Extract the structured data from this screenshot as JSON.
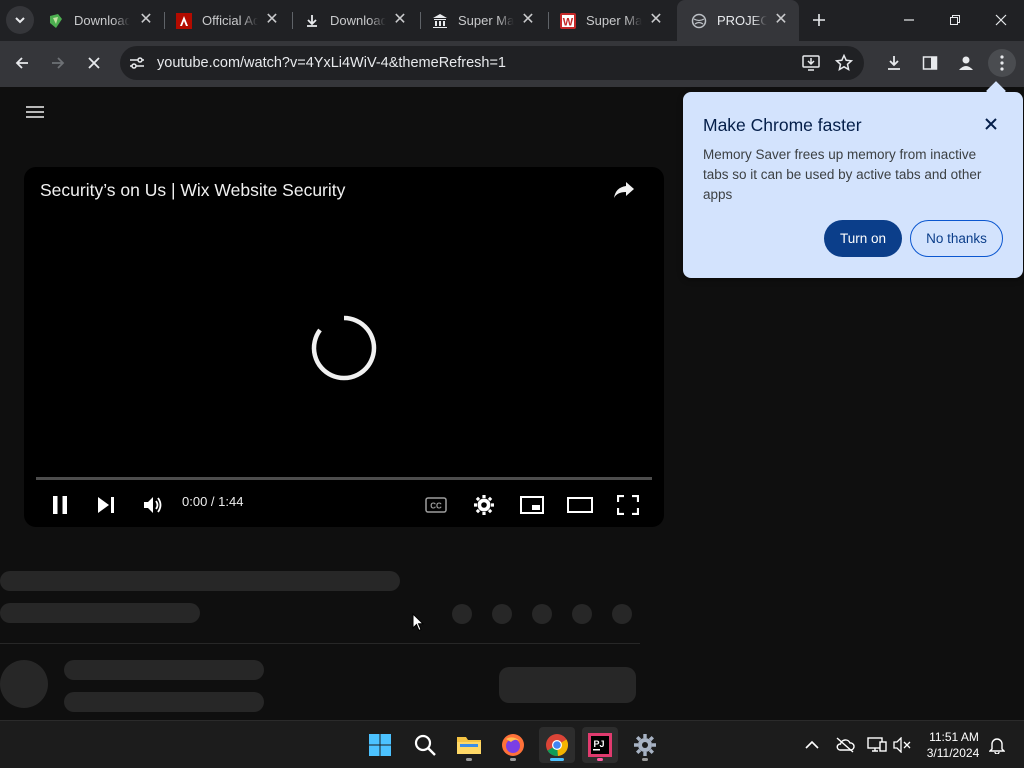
{
  "browser": {
    "tabs": [
      {
        "title": "Download",
        "favicon": "green-app-icon",
        "active": false
      },
      {
        "title": "Official Ad",
        "favicon": "adobe-icon",
        "active": false
      },
      {
        "title": "Download",
        "favicon": "download-icon",
        "active": false
      },
      {
        "title": "Super Mar",
        "favicon": "museum-icon",
        "active": false
      },
      {
        "title": "Super Mar",
        "favicon": "w-logo-icon",
        "active": false
      },
      {
        "title": "PROJECT",
        "favicon": "chrome-globe-icon",
        "active": true
      }
    ],
    "url": "youtube.com/watch?v=4YxLi4WiV-4&themeRefresh=1"
  },
  "video": {
    "title": "Security’s on Us | Wix Website Security",
    "time": "0:00 / 1:44"
  },
  "popup": {
    "title": "Make Chrome faster",
    "body": "Memory Saver frees up memory from inactive tabs so it can be used by active tabs and other apps",
    "primary_label": "Turn on",
    "secondary_label": "No thanks"
  },
  "taskbar": {
    "time": "11:51 AM",
    "date": "3/11/2024"
  },
  "colors": {
    "popup_bg": "#d3e3fd",
    "popup_primary": "#0b3e8a",
    "page_bg": "#0f0f0f"
  }
}
